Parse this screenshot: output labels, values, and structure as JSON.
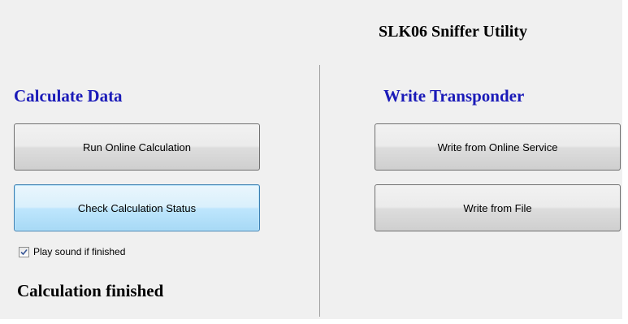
{
  "header": {
    "title": "SLK06 Sniffer Utility"
  },
  "calculate": {
    "heading": "Calculate Data",
    "run_button_label": "Run Online Calculation",
    "check_button_label": "Check Calculation Status",
    "play_sound_label": "Play sound if finished",
    "play_sound_checked": true,
    "status_text": "Calculation finished"
  },
  "write": {
    "heading": "Write Transponder",
    "online_button_label": "Write from Online Service",
    "file_button_label": "Write from File"
  },
  "colors": {
    "heading_blue": "#1a1ab8",
    "focus_border": "#3c7fb1",
    "background": "#f0f0f0"
  },
  "icons": {
    "checkbox_mark": "checkmark-icon"
  }
}
